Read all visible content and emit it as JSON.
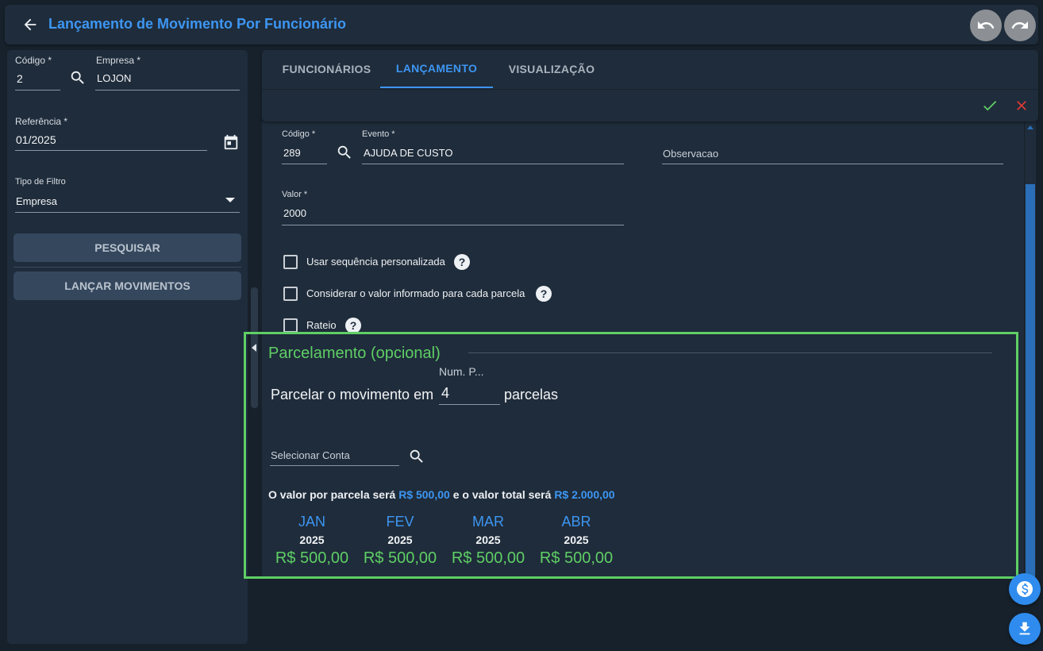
{
  "header": {
    "title": "Lançamento de Movimento Por Funcionário"
  },
  "left": {
    "codigo_label": "Código *",
    "codigo_value": "2",
    "empresa_label": "Empresa *",
    "empresa_value": "LOJON",
    "referencia_label": "Referência *",
    "referencia_value": "01/2025",
    "filtro_label": "Tipo de Filtro",
    "filtro_value": "Empresa",
    "pesquisar": "PESQUISAR",
    "lancar": "LANÇAR MOVIMENTOS"
  },
  "tabs": [
    {
      "label": "FUNCIONÁRIOS"
    },
    {
      "label": "LANÇAMENTO"
    },
    {
      "label": "VISUALIZAÇÃO"
    }
  ],
  "form": {
    "codigo_label": "Código *",
    "codigo_value": "289",
    "evento_label": "Evento *",
    "evento_value": "AJUDA DE CUSTO",
    "observacao_placeholder": "Observacao",
    "valor_label": "Valor *",
    "valor_value": "2000",
    "cb_sequencia": "Usar sequência personalizada",
    "cb_considerar": "Considerar o valor informado para cada parcela",
    "cb_rateio": "Rateio"
  },
  "parcelamento": {
    "title": "Parcelamento (opcional)",
    "num_label": "Num. P...",
    "prefix": "Parcelar o movimento em",
    "num_value": "4",
    "suffix": "parcelas",
    "conta_placeholder": "Selecionar Conta",
    "info_pre": "O valor por parcela será",
    "info_parcela": "R$ 500,00",
    "info_mid": "e o valor total será",
    "info_total": "R$ 2.000,00",
    "months": [
      {
        "month": "JAN",
        "year": "2025",
        "value": "R$ 500,00"
      },
      {
        "month": "FEV",
        "year": "2025",
        "value": "R$ 500,00"
      },
      {
        "month": "MAR",
        "year": "2025",
        "value": "R$ 500,00"
      },
      {
        "month": "ABR",
        "year": "2025",
        "value": "R$ 500,00"
      }
    ]
  },
  "colors": {
    "accent": "#3d96f2",
    "success": "#5fcf65",
    "danger": "#e53935"
  },
  "icons": [
    "back-arrow-icon",
    "undo-icon",
    "redo-icon",
    "search-icon",
    "calendar-icon",
    "dropdown-arrow-icon",
    "check-icon",
    "close-icon",
    "help-icon",
    "dollar-icon",
    "download-icon"
  ]
}
